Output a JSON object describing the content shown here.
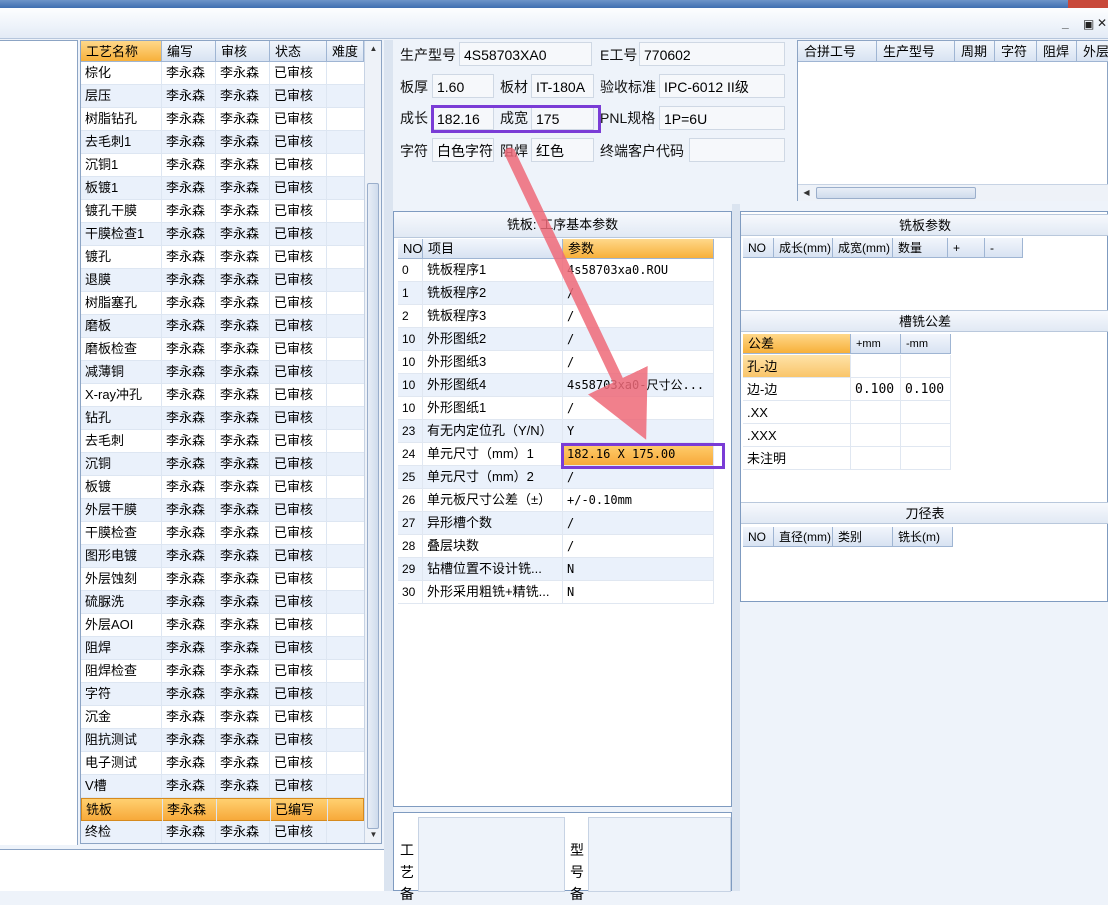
{
  "window": {
    "restore_glyph": "_ ▫ ✕"
  },
  "process_list": {
    "headers": [
      "工艺名称",
      "编写",
      "审核",
      "状态",
      "难度"
    ],
    "rows": [
      [
        "棕化",
        "李永森",
        "李永森",
        "已审核"
      ],
      [
        "层压",
        "李永森",
        "李永森",
        "已审核"
      ],
      [
        "树脂钻孔",
        "李永森",
        "李永森",
        "已审核"
      ],
      [
        "去毛刺1",
        "李永森",
        "李永森",
        "已审核"
      ],
      [
        "沉铜1",
        "李永森",
        "李永森",
        "已审核"
      ],
      [
        "板镀1",
        "李永森",
        "李永森",
        "已审核"
      ],
      [
        "镀孔干膜",
        "李永森",
        "李永森",
        "已审核"
      ],
      [
        "干膜检查1",
        "李永森",
        "李永森",
        "已审核"
      ],
      [
        "镀孔",
        "李永森",
        "李永森",
        "已审核"
      ],
      [
        "退膜",
        "李永森",
        "李永森",
        "已审核"
      ],
      [
        "树脂塞孔",
        "李永森",
        "李永森",
        "已审核"
      ],
      [
        "磨板",
        "李永森",
        "李永森",
        "已审核"
      ],
      [
        "磨板检查",
        "李永森",
        "李永森",
        "已审核"
      ],
      [
        "减薄铜",
        "李永森",
        "李永森",
        "已审核"
      ],
      [
        "X-ray冲孔",
        "李永森",
        "李永森",
        "已审核"
      ],
      [
        "钻孔",
        "李永森",
        "李永森",
        "已审核"
      ],
      [
        "去毛刺",
        "李永森",
        "李永森",
        "已审核"
      ],
      [
        "沉铜",
        "李永森",
        "李永森",
        "已审核"
      ],
      [
        "板镀",
        "李永森",
        "李永森",
        "已审核"
      ],
      [
        "外层干膜",
        "李永森",
        "李永森",
        "已审核"
      ],
      [
        "干膜检查",
        "李永森",
        "李永森",
        "已审核"
      ],
      [
        "图形电镀",
        "李永森",
        "李永森",
        "已审核"
      ],
      [
        "外层蚀刻",
        "李永森",
        "李永森",
        "已审核"
      ],
      [
        "硫脲洗",
        "李永森",
        "李永森",
        "已审核"
      ],
      [
        "外层AOI",
        "李永森",
        "李永森",
        "已审核"
      ],
      [
        "阻焊",
        "李永森",
        "李永森",
        "已审核"
      ],
      [
        "阻焊检查",
        "李永森",
        "李永森",
        "已审核"
      ],
      [
        "字符",
        "李永森",
        "李永森",
        "已审核"
      ],
      [
        "沉金",
        "李永森",
        "李永森",
        "已审核"
      ],
      [
        "阻抗测试",
        "李永森",
        "李永森",
        "已审核"
      ],
      [
        "电子测试",
        "李永森",
        "李永森",
        "已审核"
      ],
      [
        "V槽",
        "李永森",
        "李永森",
        "已审核"
      ],
      [
        "铣板",
        "李永森",
        "",
        "已编写"
      ],
      [
        "终检",
        "李永森",
        "李永森",
        "已审核"
      ]
    ],
    "selected_index": 32
  },
  "info": {
    "model_label": "生产型号",
    "model_value": "4S58703XA0",
    "e_label": "E工号",
    "e_value": "770602",
    "thick_label": "板厚",
    "thick_value": "1.60",
    "mat_label": "板材",
    "mat_value": "IT-180A",
    "std_label": "验收标准",
    "std_value": "IPC-6012 II级",
    "len_label": "成长",
    "len_value": "182.16",
    "wid_label": "成宽",
    "wid_value": "175",
    "pnl_label": "PNL规格",
    "pnl_value": "1P=6U",
    "char_label": "字符",
    "char_value": "白色字符",
    "mask_label": "阻焊",
    "mask_value": "红色",
    "cust_label": "终端客户代码",
    "cust_value": ""
  },
  "merge": {
    "headers": [
      "合拼工号",
      "生产型号",
      "周期",
      "字符",
      "阻焊",
      "外层"
    ]
  },
  "mill": {
    "title": "铣板: 工序基本参数",
    "headers": [
      "NO",
      "项目",
      "参数"
    ],
    "rows": [
      [
        "0",
        "铣板程序1",
        "4s58703xa0.ROU"
      ],
      [
        "1",
        "铣板程序2",
        "/"
      ],
      [
        "2",
        "铣板程序3",
        "/"
      ],
      [
        "10",
        "外形图纸2",
        "/"
      ],
      [
        "10",
        "外形图纸3",
        "/"
      ],
      [
        "10",
        "外形图纸4",
        "4s58703xa0-尺寸公..."
      ],
      [
        "10",
        "外形图纸1",
        "/"
      ],
      [
        "23",
        "有无内定位孔（Y/N）",
        "Y"
      ],
      [
        "24",
        "单元尺寸（mm）1",
        "182.16 X 175.00"
      ],
      [
        "25",
        "单元尺寸（mm）2",
        "/"
      ],
      [
        "26",
        "单元板尺寸公差（±）",
        "+/-0.10mm"
      ],
      [
        "27",
        "异形槽个数",
        "/"
      ],
      [
        "28",
        "叠层块数",
        "/"
      ],
      [
        "29",
        "钻槽位置不设计铣...",
        "N"
      ],
      [
        "30",
        "外形采用粗铣+精铣...",
        "N"
      ]
    ],
    "highlight_index": 8
  },
  "bottom_left": {
    "label1": "工艺备",
    "label2": "型号备"
  },
  "right": {
    "params_title": "铣板参数",
    "params_headers": [
      "NO",
      "成长(mm)",
      "成宽(mm)",
      "数量",
      "+",
      "-"
    ],
    "tol_title": "槽铣公差",
    "tol_headers": [
      "公差",
      "+mm",
      "-mm"
    ],
    "tol_rows": [
      [
        "孔-边",
        "",
        ""
      ],
      [
        "边-边",
        "0.100",
        "0.100"
      ],
      [
        ".XX",
        "",
        ""
      ],
      [
        ".XXX",
        "",
        ""
      ],
      [
        "未注明",
        "",
        ""
      ]
    ],
    "tool_title": "刀径表",
    "tool_headers": [
      "NO",
      "直径(mm)",
      "类别",
      "铣长(m)"
    ]
  },
  "colors": {
    "highlight_box": "#7a3cd6",
    "arrow": "#ef6a79",
    "selected_row": "#f7b03a"
  }
}
